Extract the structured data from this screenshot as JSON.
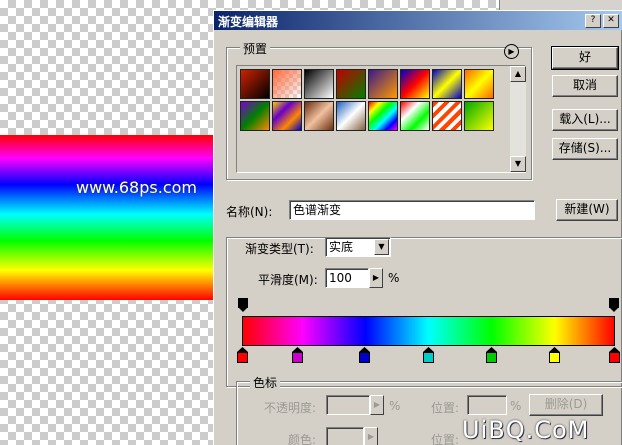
{
  "canvas": {
    "watermark_text": "www.68ps.com",
    "bottom_watermark": "UiBQ.CoM"
  },
  "dialog": {
    "title": "渐变编辑器",
    "presets": {
      "legend": "预置",
      "swatches": [
        {
          "name": "foreground-to-background",
          "colors": [
            "#cc2200",
            "#000000"
          ]
        },
        {
          "name": "foreground-to-transparent",
          "colors": [
            "#ff6a3d",
            "#f5e0d8"
          ]
        },
        {
          "name": "black-white",
          "colors": [
            "#000000",
            "#ffffff"
          ]
        },
        {
          "name": "red-green",
          "colors": [
            "#c00000",
            "#008000"
          ]
        },
        {
          "name": "violet-orange",
          "colors": [
            "#3a1a8a",
            "#ff9900"
          ]
        },
        {
          "name": "blue-red-yellow",
          "colors": [
            "#0000cc",
            "#ff0000",
            "#ffff00"
          ]
        },
        {
          "name": "blue-yellow-blue",
          "colors": [
            "#0000cc",
            "#ffff00",
            "#0000cc"
          ]
        },
        {
          "name": "orange-yellow-orange",
          "colors": [
            "#ff6600",
            "#ffff00",
            "#ff6600"
          ]
        },
        {
          "name": "violet-green-orange",
          "colors": [
            "#7a00cc",
            "#008000",
            "#ff8800"
          ]
        },
        {
          "name": "yellow-violet-orange-blue",
          "colors": [
            "#ffcc00",
            "#6600cc",
            "#ff8800",
            "#0000cc"
          ]
        },
        {
          "name": "copper",
          "colors": [
            "#6b2f10",
            "#f0c0a0",
            "#6b2f10"
          ]
        },
        {
          "name": "chrome",
          "colors": [
            "#2060c0",
            "#ffffff",
            "#806040"
          ]
        },
        {
          "name": "spectrum",
          "colors": [
            "#ff0000",
            "#ffff00",
            "#00ff00",
            "#00ffff",
            "#0000ff",
            "#ff00ff"
          ]
        },
        {
          "name": "transparent-rainbow",
          "colors": [
            "#ff0000",
            "#ffffff",
            "#00ff00",
            "#ffffff"
          ]
        },
        {
          "name": "transparent-stripes",
          "colors": [
            "#ff4400",
            "#ffffff"
          ]
        },
        {
          "name": "green-yellow",
          "colors": [
            "#00aa00",
            "#ffff00"
          ]
        }
      ]
    },
    "buttons": {
      "ok": "好",
      "cancel": "取消",
      "load": "载入(L)...",
      "save": "存储(S)...",
      "new": "新建(W)",
      "delete": "删除(D)"
    },
    "name": {
      "label": "名称(N):",
      "value": "色谱渐变"
    },
    "gradient_type": {
      "label": "渐变类型(T):",
      "value": "实底"
    },
    "smoothness": {
      "label": "平滑度(M):",
      "value": "100",
      "unit": "%"
    },
    "stops": {
      "legend": "色标",
      "opacity_label": "不透明度:",
      "opacity_unit": "%",
      "location_label": "位置:",
      "location_unit": "%",
      "color_label": "颜色:",
      "color_location_label": "位置:",
      "color_stops": [
        "#ff0000",
        "#cc00cc",
        "#0000cc",
        "#00cccc",
        "#00cc00",
        "#ffff00",
        "#ff0000"
      ],
      "color_stop_locations": [
        0,
        15,
        33,
        50,
        67,
        84,
        100
      ]
    }
  }
}
